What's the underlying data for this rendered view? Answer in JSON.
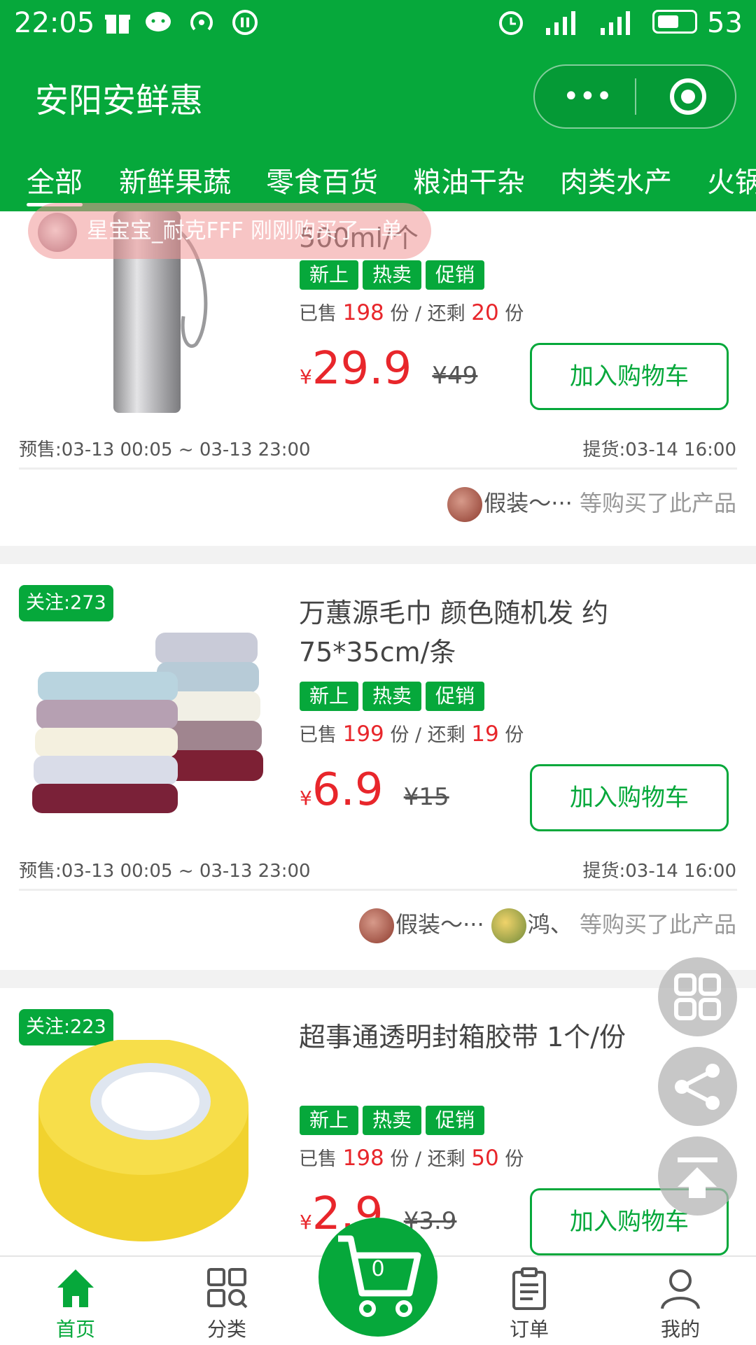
{
  "status_bar": {
    "time": "22:05",
    "battery": "53",
    "battery_level": 0.6
  },
  "header": {
    "title": "安阳安鲜惠",
    "capsule_more": "•••"
  },
  "tabs": [
    "全部",
    "新鲜果蔬",
    "零食百货",
    "粮油干杂",
    "肉类水产",
    "火锅"
  ],
  "toast": {
    "text": "星宝宝_耐克FFF 刚刚购买了一单"
  },
  "products": [
    {
      "name": "500ml/个",
      "tags": [
        "新上",
        "热卖",
        "促销"
      ],
      "sold_label": "已售",
      "sold": "198",
      "unit": "份",
      "remain_label": "还剩",
      "remain": "20",
      "currency": "¥",
      "price": "29.9",
      "orig_price": "¥49",
      "cart_button": "加入购物车",
      "pre_sale": "预售:03-13 00:05 ~ 03-13 23:00",
      "pickup": "提货:03-14 16:00",
      "buyers": [
        "假装～···"
      ],
      "buyers_suffix": "等购买了此产品"
    },
    {
      "follow": "关注:273",
      "name": "万蕙源毛巾 颜色随机发 约75*35cm/条",
      "tags": [
        "新上",
        "热卖",
        "促销"
      ],
      "sold_label": "已售",
      "sold": "199",
      "unit": "份",
      "remain_label": "还剩",
      "remain": "19",
      "currency": "¥",
      "price": "6.9",
      "orig_price": "¥15",
      "cart_button": "加入购物车",
      "pre_sale": "预售:03-13 00:05 ~ 03-13 23:00",
      "pickup": "提货:03-14 16:00",
      "buyers": [
        "假装～···",
        "鸿、"
      ],
      "buyers_suffix": "等购买了此产品"
    },
    {
      "follow": "关注:223",
      "name": "超事通透明封箱胶带 1个/份",
      "tags": [
        "新上",
        "热卖",
        "促销"
      ],
      "sold_label": "已售",
      "sold": "198",
      "unit": "份",
      "remain_label": "还剩",
      "remain": "50",
      "currency": "¥",
      "price": "2.9",
      "orig_price": "¥3.9",
      "cart_button": "加入购物车"
    }
  ],
  "bottom_nav": {
    "home": "首页",
    "category": "分类",
    "cart_count": "0",
    "orders": "订单",
    "mine": "我的"
  },
  "colors": {
    "brand": "#06a83b",
    "price": "#e8262b"
  }
}
